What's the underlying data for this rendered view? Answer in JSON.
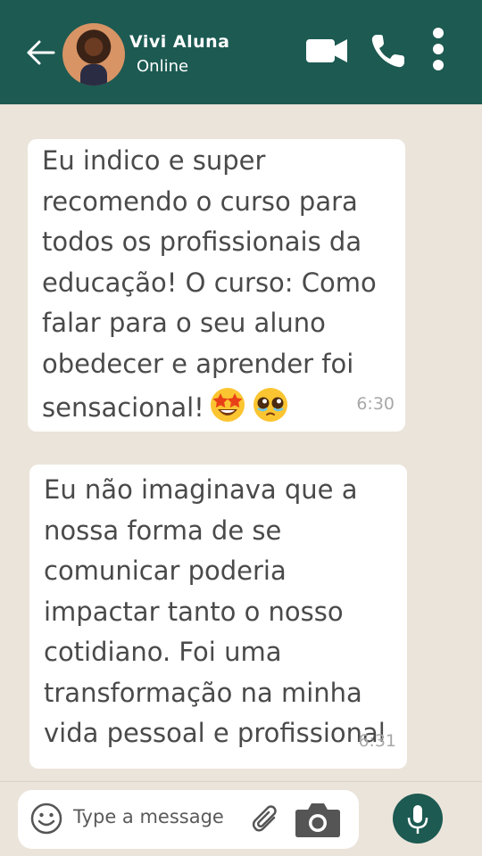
{
  "header": {
    "contact_name": "Vivi Aluna",
    "status": "Online",
    "icons": [
      "back-arrow-icon",
      "avatar",
      "video-call-icon",
      "phone-call-icon",
      "more-options-icon"
    ]
  },
  "messages": [
    {
      "text": "Eu indico e super recomendo o curso para todos os profissionais da educação! O curso: Como falar para o seu aluno obedecer e aprender foi sensacional!",
      "emojis": [
        "star-struck-emoji",
        "pleading-face-emoji"
      ],
      "time": "6:30"
    },
    {
      "text": "Eu não imaginava que a nossa forma de se comunicar poderia impactar tanto o nosso cotidiano. Foi uma transformação na minha vida pessoal e profissional",
      "time": "6:31"
    }
  ],
  "composer": {
    "placeholder": "Type a message",
    "icons": [
      "emoji-icon",
      "attach-icon",
      "camera-icon",
      "mic-icon"
    ]
  },
  "colors": {
    "header_bg": "#1c5a52",
    "chat_bg": "#ebe4da",
    "bubble_bg": "#ffffff",
    "text": "#4a4a4a",
    "timestamp": "#a8a8a8"
  }
}
